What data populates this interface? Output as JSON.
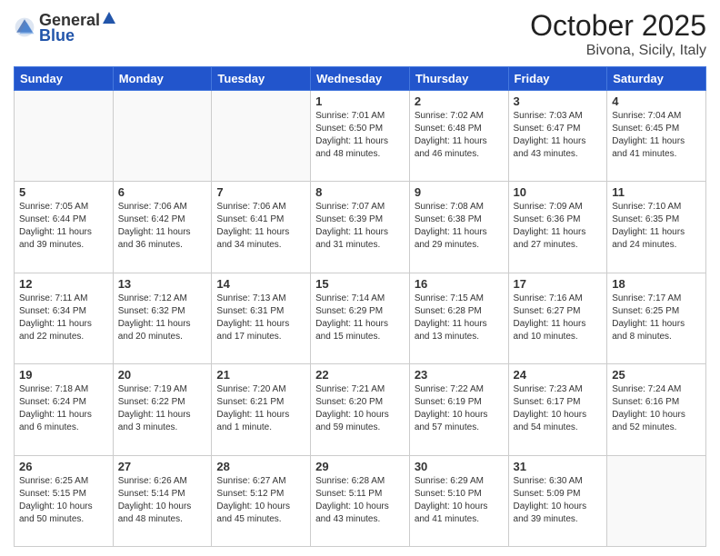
{
  "header": {
    "logo_general": "General",
    "logo_blue": "Blue",
    "month": "October 2025",
    "location": "Bivona, Sicily, Italy"
  },
  "weekdays": [
    "Sunday",
    "Monday",
    "Tuesday",
    "Wednesday",
    "Thursday",
    "Friday",
    "Saturday"
  ],
  "weeks": [
    [
      {
        "day": "",
        "info": ""
      },
      {
        "day": "",
        "info": ""
      },
      {
        "day": "",
        "info": ""
      },
      {
        "day": "1",
        "info": "Sunrise: 7:01 AM\nSunset: 6:50 PM\nDaylight: 11 hours\nand 48 minutes."
      },
      {
        "day": "2",
        "info": "Sunrise: 7:02 AM\nSunset: 6:48 PM\nDaylight: 11 hours\nand 46 minutes."
      },
      {
        "day": "3",
        "info": "Sunrise: 7:03 AM\nSunset: 6:47 PM\nDaylight: 11 hours\nand 43 minutes."
      },
      {
        "day": "4",
        "info": "Sunrise: 7:04 AM\nSunset: 6:45 PM\nDaylight: 11 hours\nand 41 minutes."
      }
    ],
    [
      {
        "day": "5",
        "info": "Sunrise: 7:05 AM\nSunset: 6:44 PM\nDaylight: 11 hours\nand 39 minutes."
      },
      {
        "day": "6",
        "info": "Sunrise: 7:06 AM\nSunset: 6:42 PM\nDaylight: 11 hours\nand 36 minutes."
      },
      {
        "day": "7",
        "info": "Sunrise: 7:06 AM\nSunset: 6:41 PM\nDaylight: 11 hours\nand 34 minutes."
      },
      {
        "day": "8",
        "info": "Sunrise: 7:07 AM\nSunset: 6:39 PM\nDaylight: 11 hours\nand 31 minutes."
      },
      {
        "day": "9",
        "info": "Sunrise: 7:08 AM\nSunset: 6:38 PM\nDaylight: 11 hours\nand 29 minutes."
      },
      {
        "day": "10",
        "info": "Sunrise: 7:09 AM\nSunset: 6:36 PM\nDaylight: 11 hours\nand 27 minutes."
      },
      {
        "day": "11",
        "info": "Sunrise: 7:10 AM\nSunset: 6:35 PM\nDaylight: 11 hours\nand 24 minutes."
      }
    ],
    [
      {
        "day": "12",
        "info": "Sunrise: 7:11 AM\nSunset: 6:34 PM\nDaylight: 11 hours\nand 22 minutes."
      },
      {
        "day": "13",
        "info": "Sunrise: 7:12 AM\nSunset: 6:32 PM\nDaylight: 11 hours\nand 20 minutes."
      },
      {
        "day": "14",
        "info": "Sunrise: 7:13 AM\nSunset: 6:31 PM\nDaylight: 11 hours\nand 17 minutes."
      },
      {
        "day": "15",
        "info": "Sunrise: 7:14 AM\nSunset: 6:29 PM\nDaylight: 11 hours\nand 15 minutes."
      },
      {
        "day": "16",
        "info": "Sunrise: 7:15 AM\nSunset: 6:28 PM\nDaylight: 11 hours\nand 13 minutes."
      },
      {
        "day": "17",
        "info": "Sunrise: 7:16 AM\nSunset: 6:27 PM\nDaylight: 11 hours\nand 10 minutes."
      },
      {
        "day": "18",
        "info": "Sunrise: 7:17 AM\nSunset: 6:25 PM\nDaylight: 11 hours\nand 8 minutes."
      }
    ],
    [
      {
        "day": "19",
        "info": "Sunrise: 7:18 AM\nSunset: 6:24 PM\nDaylight: 11 hours\nand 6 minutes."
      },
      {
        "day": "20",
        "info": "Sunrise: 7:19 AM\nSunset: 6:22 PM\nDaylight: 11 hours\nand 3 minutes."
      },
      {
        "day": "21",
        "info": "Sunrise: 7:20 AM\nSunset: 6:21 PM\nDaylight: 11 hours\nand 1 minute."
      },
      {
        "day": "22",
        "info": "Sunrise: 7:21 AM\nSunset: 6:20 PM\nDaylight: 10 hours\nand 59 minutes."
      },
      {
        "day": "23",
        "info": "Sunrise: 7:22 AM\nSunset: 6:19 PM\nDaylight: 10 hours\nand 57 minutes."
      },
      {
        "day": "24",
        "info": "Sunrise: 7:23 AM\nSunset: 6:17 PM\nDaylight: 10 hours\nand 54 minutes."
      },
      {
        "day": "25",
        "info": "Sunrise: 7:24 AM\nSunset: 6:16 PM\nDaylight: 10 hours\nand 52 minutes."
      }
    ],
    [
      {
        "day": "26",
        "info": "Sunrise: 6:25 AM\nSunset: 5:15 PM\nDaylight: 10 hours\nand 50 minutes."
      },
      {
        "day": "27",
        "info": "Sunrise: 6:26 AM\nSunset: 5:14 PM\nDaylight: 10 hours\nand 48 minutes."
      },
      {
        "day": "28",
        "info": "Sunrise: 6:27 AM\nSunset: 5:12 PM\nDaylight: 10 hours\nand 45 minutes."
      },
      {
        "day": "29",
        "info": "Sunrise: 6:28 AM\nSunset: 5:11 PM\nDaylight: 10 hours\nand 43 minutes."
      },
      {
        "day": "30",
        "info": "Sunrise: 6:29 AM\nSunset: 5:10 PM\nDaylight: 10 hours\nand 41 minutes."
      },
      {
        "day": "31",
        "info": "Sunrise: 6:30 AM\nSunset: 5:09 PM\nDaylight: 10 hours\nand 39 minutes."
      },
      {
        "day": "",
        "info": ""
      }
    ]
  ]
}
